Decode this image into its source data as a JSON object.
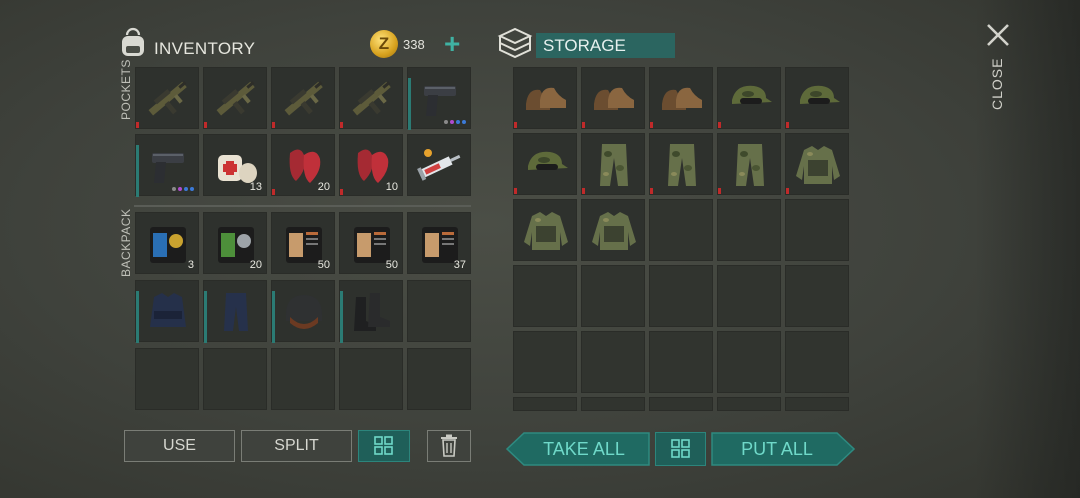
{
  "inventory": {
    "title": "INVENTORY",
    "coin_symbol": "Z",
    "coins": "338",
    "add_label": "+",
    "pockets_label": "POCKETS",
    "backpack_label": "BACKPACK",
    "pockets": [
      {
        "item": "assault-rifle",
        "qty": ""
      },
      {
        "item": "assault-rifle",
        "qty": ""
      },
      {
        "item": "assault-rifle",
        "qty": ""
      },
      {
        "item": "assault-rifle",
        "qty": ""
      },
      {
        "item": "pistol",
        "qty": ""
      },
      {
        "item": "pistol",
        "qty": ""
      },
      {
        "item": "bandage",
        "qty": "13"
      },
      {
        "item": "red-cloth",
        "qty": "20"
      },
      {
        "item": "red-cloth",
        "qty": "10"
      },
      {
        "item": "syringe",
        "qty": ""
      }
    ],
    "backpack": [
      {
        "item": "police-badge-blue",
        "qty": "3"
      },
      {
        "item": "badge-green",
        "qty": "20"
      },
      {
        "item": "document",
        "qty": "50"
      },
      {
        "item": "document",
        "qty": "50"
      },
      {
        "item": "document",
        "qty": "37"
      },
      {
        "item": "police-vest",
        "qty": ""
      },
      {
        "item": "police-pants",
        "qty": ""
      },
      {
        "item": "riot-helmet",
        "qty": ""
      },
      {
        "item": "combat-boots",
        "qty": ""
      },
      {
        "item": "",
        "qty": ""
      },
      {
        "item": "",
        "qty": ""
      },
      {
        "item": "",
        "qty": ""
      },
      {
        "item": "",
        "qty": ""
      },
      {
        "item": "",
        "qty": ""
      },
      {
        "item": "",
        "qty": ""
      }
    ]
  },
  "storage": {
    "title": "STORAGE",
    "items": [
      "boots",
      "boots",
      "boots",
      "camo-cap",
      "camo-cap",
      "camo-cap",
      "camo-pants",
      "camo-pants",
      "camo-pants",
      "camo-jacket",
      "camo-jacket",
      "camo-jacket",
      "",
      "",
      "",
      "",
      "",
      "",
      "",
      "",
      "",
      "",
      "",
      "",
      ""
    ]
  },
  "buttons": {
    "use": "USE",
    "split": "SPLIT",
    "take_all": "TAKE ALL",
    "put_all": "PUT ALL"
  },
  "close_label": "CLOSE",
  "colors": {
    "accent": "#2b6560",
    "teal_text": "#6fd9c9",
    "red_marker": "#c02a2a"
  }
}
